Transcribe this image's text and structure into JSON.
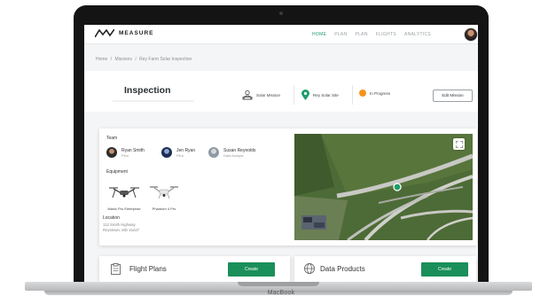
{
  "app": {
    "brand": "MEASURE"
  },
  "nav": {
    "items": [
      "HOME",
      "PLAN",
      "PLAN",
      "FLIGHTS",
      "ANALYTICS"
    ]
  },
  "breadcrumb": [
    "Home",
    "/",
    "Missions",
    "/",
    "Rey Farm Solar Inspection"
  ],
  "header": {
    "title": "Inspection",
    "mission_type": "Solar Mission",
    "site": "Rey Solar Site",
    "status": "In Progress",
    "edit_label": "Edit Mission",
    "status_color": "#f7941d",
    "site_pin_color": "#1f9d6a"
  },
  "team": {
    "label": "Team",
    "members": [
      {
        "name": "Ryan Smith",
        "role": "Pilot"
      },
      {
        "name": "Jen Ryan",
        "role": "Pilot"
      },
      {
        "name": "Susan Reynolds",
        "role": "Data Analyst"
      }
    ]
  },
  "equipment": {
    "label": "Equipment",
    "items": [
      "Mavic Pro Enterprise",
      "Phantom 4 Pro"
    ]
  },
  "location": {
    "label": "Location",
    "line1": "112 Smith Highway",
    "line2": "Reystown, MD 15437"
  },
  "cards": {
    "flight_plans": {
      "title": "Flight Plans",
      "button": "Create"
    },
    "data_products": {
      "title": "Data Products",
      "button": "Create"
    }
  },
  "device": {
    "brand": "MacBook"
  },
  "colors": {
    "accent": "#1b8f5a",
    "nav_active": "#1f9d6a"
  }
}
